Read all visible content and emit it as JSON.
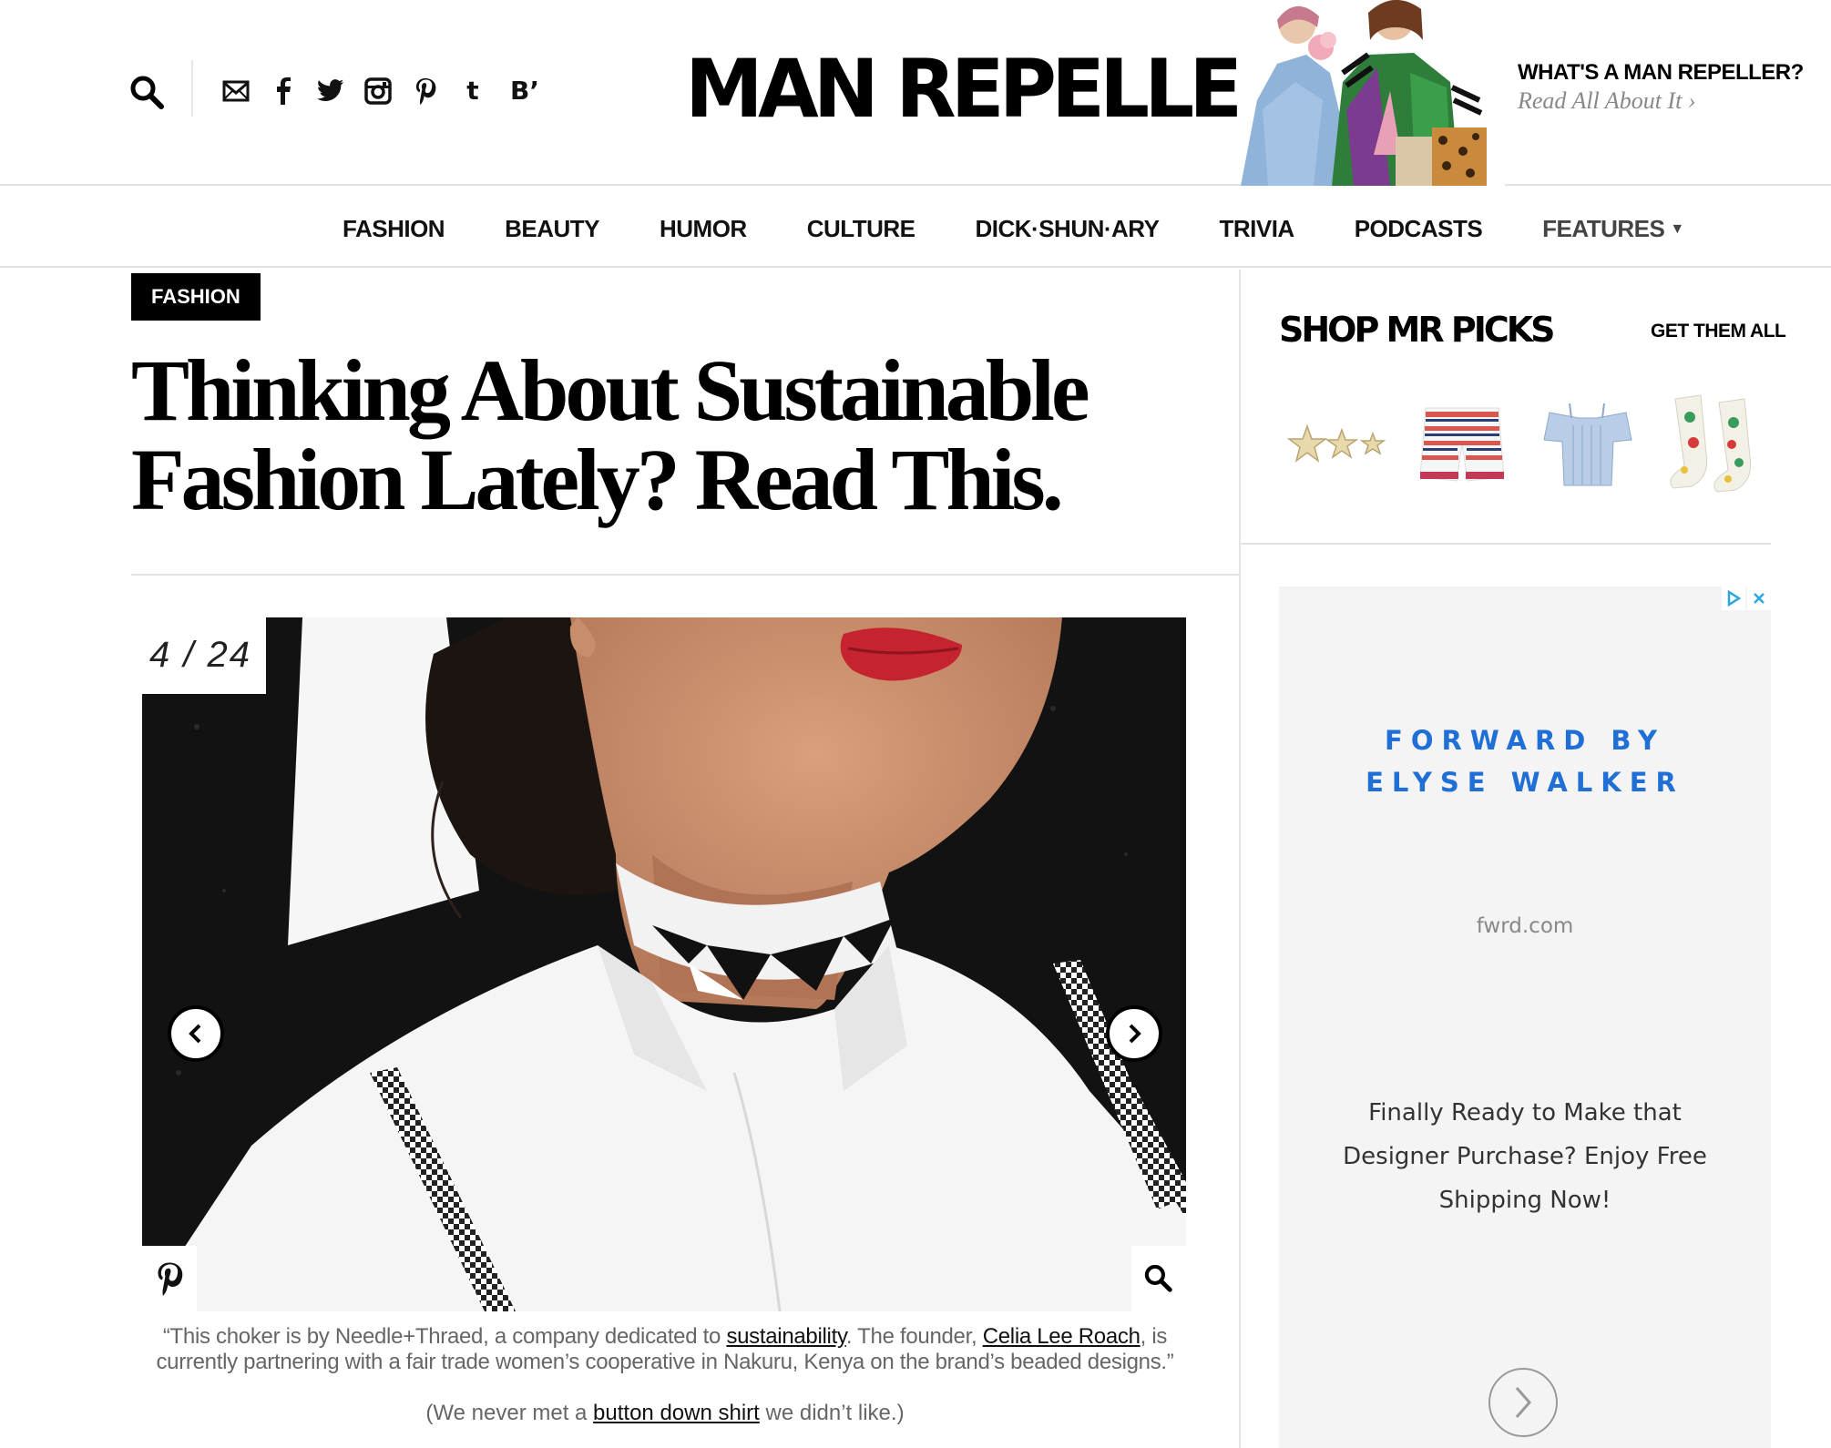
{
  "header": {
    "logo": "MAN REPELLER",
    "whats_title": "WHAT'S A MAN REPELLER?",
    "whats_link": "Read All About It ›",
    "social": {
      "tumblr": "t",
      "bloglovin": "B’"
    }
  },
  "nav": {
    "items": [
      "FASHION",
      "BEAUTY",
      "HUMOR",
      "CULTURE",
      "DICK·SHUN·ARY",
      "TRIVIA",
      "PODCASTS"
    ],
    "features": "FEATURES"
  },
  "article": {
    "category": "FASHION",
    "title": "Thinking About Sustainable Fashion Lately? Read This.",
    "slide_counter": "4 / 24",
    "caption": {
      "p1": "“This choker is by Needle+Thraed, a company dedicated to ",
      "link1": "sustainability",
      "p2": ". The founder, ",
      "link2": "Celia Lee Roach",
      "p3": ", is currently partnering with a fair trade women’s cooperative in Nakuru, Kenya on the brand’s beaded designs.”"
    },
    "note": {
      "p1": "(We never met a ",
      "link": "button down shirt",
      "p2": " we didn’t like.)"
    }
  },
  "sidebar": {
    "shop_title": "SHOP MR PICKS",
    "get_all": "GET THEM ALL",
    "picks": [
      "star-hair-clip",
      "striped-shorts",
      "blue-off-shoulder-top",
      "dinosaur-socks"
    ]
  },
  "ad": {
    "brand_line1": "FORWARD BY",
    "brand_line2": "ELYSE WALKER",
    "url": "fwrd.com",
    "copy": "Finally Ready to Make that Designer Purchase? Enjoy Free Shipping Now!"
  },
  "colors": {
    "ad_blue": "#1f6fd6",
    "lipstick": "#c4232f",
    "rule": "#e4e4e4"
  }
}
